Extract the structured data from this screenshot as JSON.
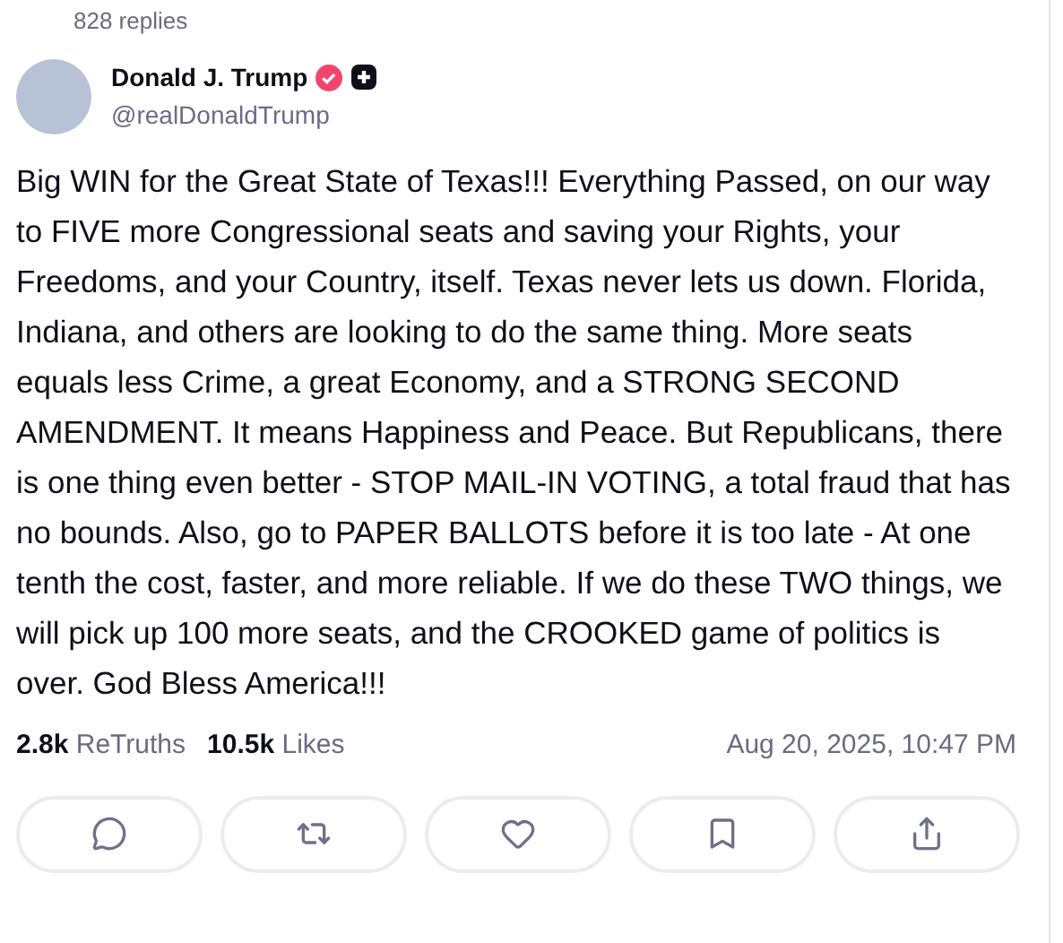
{
  "replies_count": "828 replies",
  "author": {
    "name": "Donald J. Trump",
    "handle": "@realDonaldTrump"
  },
  "post": {
    "text": "Big WIN for the Great State of Texas!!! Everything Passed, on our way to FIVE more Congressional seats and saving your Rights, your Freedoms, and your Country, itself. Texas never lets us down. Florida, Indiana, and others are looking to do the same thing. More seats equals less Crime, a great Economy, and a STRONG SECOND AMENDMENT. It means Happiness and Peace. But Republicans, there is one thing even better - STOP MAIL-IN VOTING, a total fraud that has no bounds. Also, go to PAPER BALLOTS before it is too late - At one tenth the cost, faster, and more reliable. If we do these TWO things, we will pick up 100 more seats, and the CROOKED game of politics is over. God Bless America!!!"
  },
  "stats": [
    {
      "count": "2.8k",
      "label": "ReTruths"
    },
    {
      "count": "10.5k",
      "label": "Likes"
    }
  ],
  "timestamp": "Aug 20, 2025, 10:47 PM",
  "actions": [
    {
      "kind": "reply"
    },
    {
      "kind": "retruth"
    },
    {
      "kind": "like"
    },
    {
      "kind": "bookmark"
    },
    {
      "kind": "share"
    }
  ]
}
